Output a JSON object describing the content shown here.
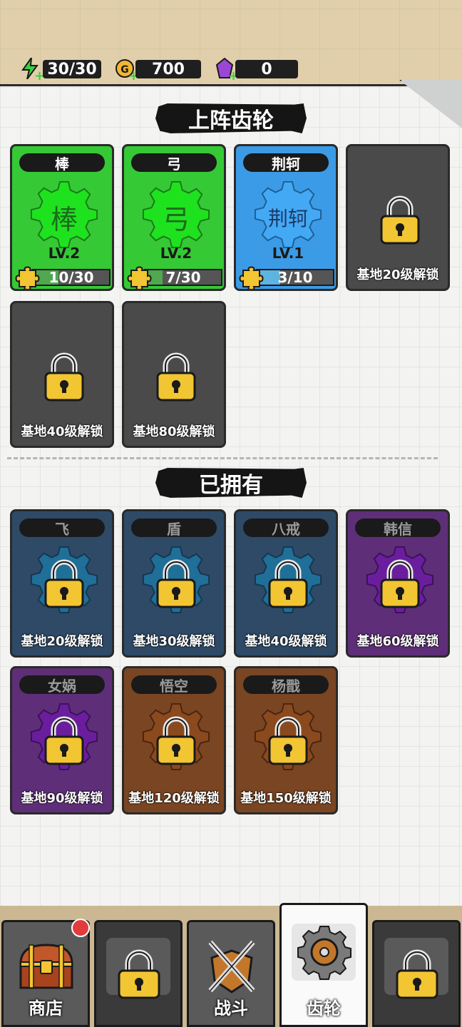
{
  "resources": {
    "energy": "30/30",
    "coins": "700",
    "gems": "0"
  },
  "sections": {
    "equipped_title": "上阵齿轮",
    "owned_title": "已拥有"
  },
  "equipped": [
    {
      "name": "棒",
      "level": "LV.2",
      "progress": "10/30",
      "progress_fraction": 0.33,
      "color": "#35c935",
      "glyph": "棒"
    },
    {
      "name": "弓",
      "level": "LV.2",
      "progress": "7/30",
      "progress_fraction": 0.23,
      "color": "#35c935",
      "glyph": "弓"
    },
    {
      "name": "荆轲",
      "level": "LV.1",
      "progress": "3/10",
      "progress_fraction": 0.3,
      "color": "#3c9be6",
      "glyph": "荆轲"
    }
  ],
  "equipped_locked": [
    {
      "unlock": "基地20级解锁"
    },
    {
      "unlock": "基地40级解锁"
    },
    {
      "unlock": "基地80级解锁"
    }
  ],
  "owned": [
    {
      "name": "飞",
      "unlock": "基地20级解锁",
      "color": "#2e4a66"
    },
    {
      "name": "盾",
      "unlock": "基地30级解锁",
      "color": "#2e4a66"
    },
    {
      "name": "八戒",
      "unlock": "基地40级解锁",
      "color": "#2e4a66"
    },
    {
      "name": "韩信",
      "unlock": "基地60级解锁",
      "color": "#5e2f78"
    },
    {
      "name": "女娲",
      "unlock": "基地90级解锁",
      "color": "#5e2f78"
    },
    {
      "name": "悟空",
      "unlock": "基地120级解锁",
      "color": "#7a4522"
    },
    {
      "name": "杨戬",
      "unlock": "基地150级解锁",
      "color": "#7a4522"
    }
  ],
  "tabs": {
    "shop": "商店",
    "battle": "战斗",
    "gears": "齿轮"
  }
}
